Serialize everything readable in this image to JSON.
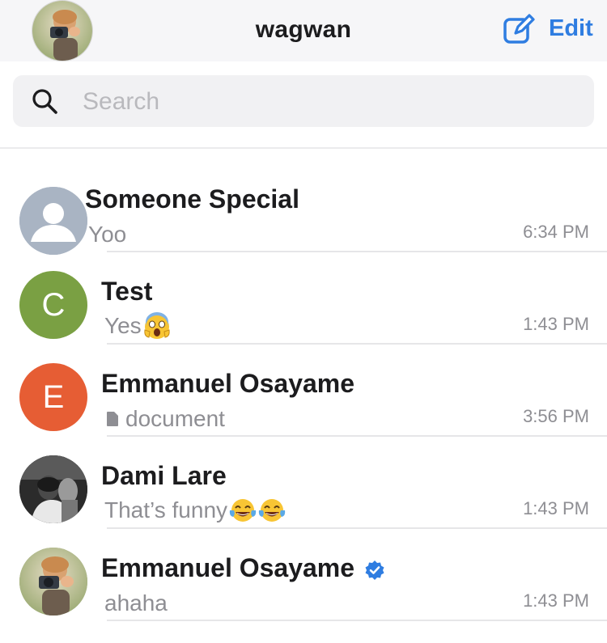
{
  "header": {
    "title": "wagwan",
    "edit_label": "Edit",
    "compose_icon": "compose-icon",
    "accent": "#2f7de1"
  },
  "search": {
    "placeholder": "Search",
    "value": ""
  },
  "chats": [
    {
      "name": "Someone Special",
      "preview": "Yoo",
      "time": "6:34 PM",
      "avatar_type": "placeholder-person-icon",
      "avatar_color": "#a9b4c3"
    },
    {
      "name": "Test",
      "preview": "Yes",
      "preview_emoji": [
        "scream-emoji"
      ],
      "time": "1:43 PM",
      "avatar_type": "initial",
      "initial": "C",
      "avatar_color": "#7aa043"
    },
    {
      "name": "Emmanuel Osayame",
      "preview": "document",
      "preview_icon": "document-icon",
      "time": "3:56 PM",
      "avatar_type": "initial",
      "initial": "E",
      "avatar_color": "#e65d34"
    },
    {
      "name": "Dami Lare",
      "preview": "That’s funny",
      "preview_emoji": [
        "tears-of-joy-emoji",
        "tears-of-joy-emoji"
      ],
      "time": "1:43 PM",
      "avatar_type": "photo-bw"
    },
    {
      "name": "Emmanuel Osayame",
      "preview": "ahaha",
      "time": "1:43 PM",
      "avatar_type": "photo-child",
      "verified": true,
      "verified_color": "#2f7de1"
    }
  ]
}
